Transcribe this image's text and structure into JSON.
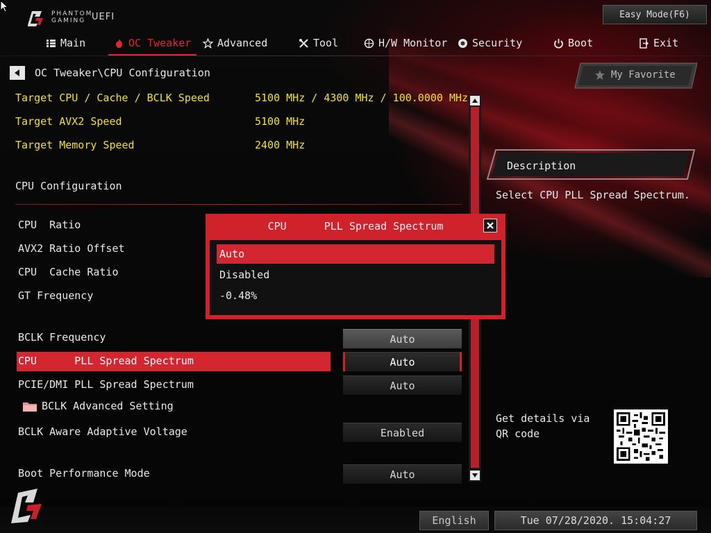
{
  "app": {
    "brand_line1": "PHANTOM",
    "brand_line2": "GAMING",
    "brand_uefi": "UEFI",
    "easy_mode_label": "Easy Mode(F6)"
  },
  "tabs": [
    {
      "label": "Main",
      "icon": "list-icon",
      "active": false
    },
    {
      "label": "OC Tweaker",
      "icon": "flame-icon",
      "active": true
    },
    {
      "label": "Advanced",
      "icon": "star-icon",
      "active": false
    },
    {
      "label": "Tool",
      "icon": "tools-icon",
      "active": false
    },
    {
      "label": "H/W Monitor",
      "icon": "monitor-icon",
      "active": false
    },
    {
      "label": "Security",
      "icon": "shield-icon",
      "active": false
    },
    {
      "label": "Boot",
      "icon": "power-icon",
      "active": false
    },
    {
      "label": "Exit",
      "icon": "exit-icon",
      "active": false
    }
  ],
  "breadcrumb": "OC Tweaker\\CPU Configuration",
  "targets": [
    {
      "label": "Target CPU / Cache / BCLK Speed",
      "value": "5100 MHz / 4300 MHz / 100.0000 MHz"
    },
    {
      "label": "Target AVX2 Speed",
      "value": "5100 MHz"
    },
    {
      "label": "Target Memory Speed",
      "value": "2400 MHz"
    }
  ],
  "section_title": "CPU Configuration",
  "settings": {
    "cpu_ratio": "CPU  Ratio",
    "avx2_ratio_offset": "AVX2 Ratio Offset",
    "cpu_cache_ratio": "CPU  Cache Ratio",
    "gt_frequency": "GT Frequency",
    "bclk_frequency": {
      "label": "BCLK Frequency",
      "value": "Auto"
    },
    "cpu_pll_spread": {
      "label": "CPU      PLL Spread Spectrum",
      "value": "Auto"
    },
    "pcie_dmi_pll_spread": {
      "label": "PCIE/DMI PLL Spread Spectrum",
      "value": "Auto"
    },
    "bclk_advanced": "BCLK Advanced Setting",
    "bclk_aware_voltage": {
      "label": "BCLK Aware Adaptive Voltage",
      "value": "Enabled"
    },
    "boot_performance_mode": {
      "label": "Boot Performance Mode",
      "value": "Auto"
    }
  },
  "my_favorite": "My Favorite",
  "description": {
    "heading": "Description",
    "text": "Select CPU PLL Spread Spectrum."
  },
  "qr": {
    "text": "Get details via QR code"
  },
  "dialog": {
    "title": "CPU      PLL Spread Spectrum",
    "options": [
      "Auto",
      "Disabled",
      "-0.48%"
    ],
    "selected_index": 0
  },
  "footer": {
    "language": "English",
    "datetime": "Tue 07/28/2020. 15:04:27"
  },
  "colors": {
    "accent_red": "#d42630",
    "target_yellow": "#f1e21a"
  }
}
